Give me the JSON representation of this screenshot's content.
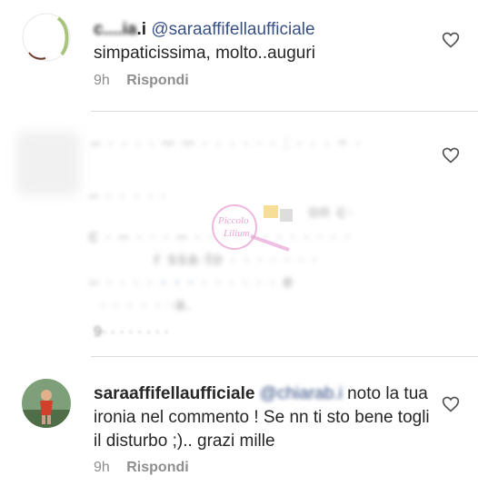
{
  "comments": [
    {
      "username_partial": ".i",
      "mention": "@saraaffifellaufficiale",
      "body": "simpaticissima, molto..auguri",
      "time": "9h",
      "reply": "Rispondi"
    },
    {
      "time_partial": "9",
      "note": "blurred comment"
    },
    {
      "username": "saraaffifellaufficiale",
      "mention": "@chiarab.i",
      "body": " noto la tua ironia nel commento ! Se nn ti sto bene togli il disturbo ;).. grazi mille",
      "time": "9h",
      "reply": "Rispondi"
    }
  ],
  "icons": {
    "like": "heart-outline-icon"
  },
  "colors": {
    "mention": "#385185",
    "meta": "#8e8e8e",
    "divider": "#dbdbdb"
  }
}
